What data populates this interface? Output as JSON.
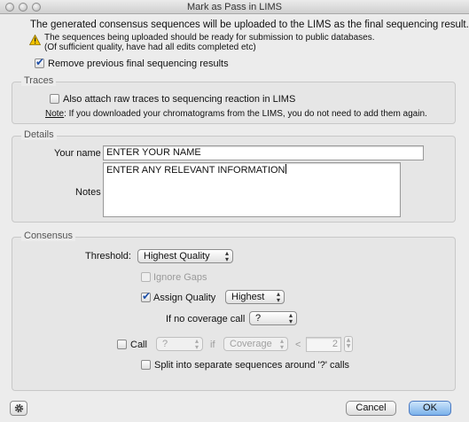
{
  "window": {
    "title": "Mark as Pass in LIMS"
  },
  "intro": {
    "text": "The generated consensus sequences will be uploaded to the LIMS as the final sequencing result.",
    "warning_line1": "The sequences being uploaded should be ready for submission to public databases.",
    "warning_line2": "(Of sufficient quality, have had all edits completed etc)",
    "warning_icon": "warning-triangle-icon",
    "remove_previous_label": "Remove previous final sequencing results",
    "remove_previous_checked": true
  },
  "traces": {
    "legend": "Traces",
    "attach_label": "Also attach raw traces to sequencing reaction in LIMS",
    "attach_checked": false,
    "note_prefix": "Note",
    "note_text": ": If you downloaded your chromatograms from the LIMS, you do not need to add them again."
  },
  "details": {
    "legend": "Details",
    "name_label": "Your name",
    "name_value": "ENTER YOUR NAME",
    "notes_label": "Notes",
    "notes_value": "ENTER ANY RELEVANT INFORMATION"
  },
  "consensus": {
    "legend": "Consensus",
    "threshold_label": "Threshold:",
    "threshold_value": "Highest Quality",
    "ignore_gaps_label": "Ignore Gaps",
    "ignore_gaps_checked": false,
    "assign_quality_label": "Assign Quality",
    "assign_quality_checked": true,
    "assign_quality_value": "Highest",
    "no_coverage_label": "If no coverage call",
    "no_coverage_value": "?",
    "call_label": "Call",
    "call_checked": false,
    "call_value": "?",
    "if_label": "if",
    "coverage_value": "Coverage",
    "less_than": "<",
    "coverage_threshold": "2",
    "split_label": "Split into separate sequences around '?' calls",
    "split_checked": false
  },
  "footer": {
    "gear_icon": "gear-icon",
    "cancel_label": "Cancel",
    "ok_label": "OK"
  },
  "colors": {
    "accent": "#1d4fa8",
    "default_button": "#7ab1ea",
    "warning": "#f2c200"
  }
}
